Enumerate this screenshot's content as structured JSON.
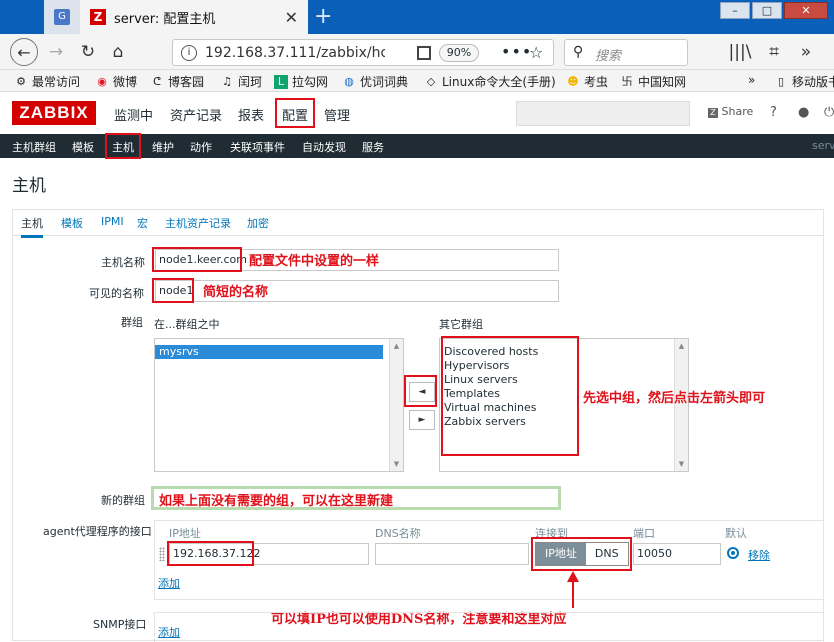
{
  "browser": {
    "tab_title": "server: 配置主机",
    "tab_favicon": "Z",
    "new_tab": "+",
    "url": "192.168.37.111/zabbix/hos",
    "zoom": "90%",
    "search_placeholder": "搜索",
    "bookmarks": [
      "最常访问",
      "微博",
      "博客园",
      "闰珂",
      "拉勾网",
      "优词词典",
      "Linux命令大全(手册)",
      "考虫",
      "中国知网",
      "移动版书"
    ],
    "lagou_badge": "L"
  },
  "zabbix": {
    "logo": "ZABBIX",
    "menu": [
      "监测中",
      "资产记录",
      "报表",
      "配置",
      "管理"
    ],
    "share": "Share",
    "help": "?",
    "submenu": [
      "主机群组",
      "模板",
      "主机",
      "维护",
      "动作",
      "关联项事件",
      "自动发现",
      "服务"
    ],
    "server_label": "serv"
  },
  "page": {
    "title": "主机",
    "tabs": [
      "主机",
      "模板",
      "IPMI",
      "宏",
      "主机资产记录",
      "加密"
    ],
    "hostname_label": "主机名称",
    "hostname_value": "node1.keer.com",
    "visible_label": "可见的名称",
    "visible_value": "node1",
    "groups_label": "群组",
    "in_groups_label": "在...群组之中",
    "other_groups_label": "其它群组",
    "in_groups": [
      "mysrvs"
    ],
    "other_groups": [
      "Discovered hosts",
      "Hypervisors",
      "Linux servers",
      "Templates",
      "Virtual machines",
      "Zabbix servers"
    ],
    "move_left": "◄",
    "move_right": "►",
    "new_group_label": "新的群组",
    "agent_label": "agent代理程序的接口",
    "col_ip": "IP地址",
    "col_dns": "DNS名称",
    "col_connect": "连接到",
    "col_port": "端口",
    "col_default": "默认",
    "ip_value": "192.168.37.122",
    "dns_value": "",
    "connect_ip": "IP地址",
    "connect_dns": "DNS",
    "port_value": "10050",
    "remove": "移除",
    "add": "添加",
    "snmp_label": "SNMP接口",
    "snmp_add": "添加"
  },
  "annotations": {
    "hostname_note": "配置文件中设置的一样",
    "visible_note": "简短的名称",
    "group_note": "先选中组，然后点击左箭头即可",
    "new_group_note": "如果上面没有需要的组，可以在这里新建",
    "connect_note": "可以填IP也可以使用DNS名称，注意要和这里对应"
  },
  "colors": {
    "accent": "#0275b8",
    "annotation_red": "#e0111b",
    "zabbix_red": "#d40000",
    "submenu_bg": "#1f2c33"
  }
}
